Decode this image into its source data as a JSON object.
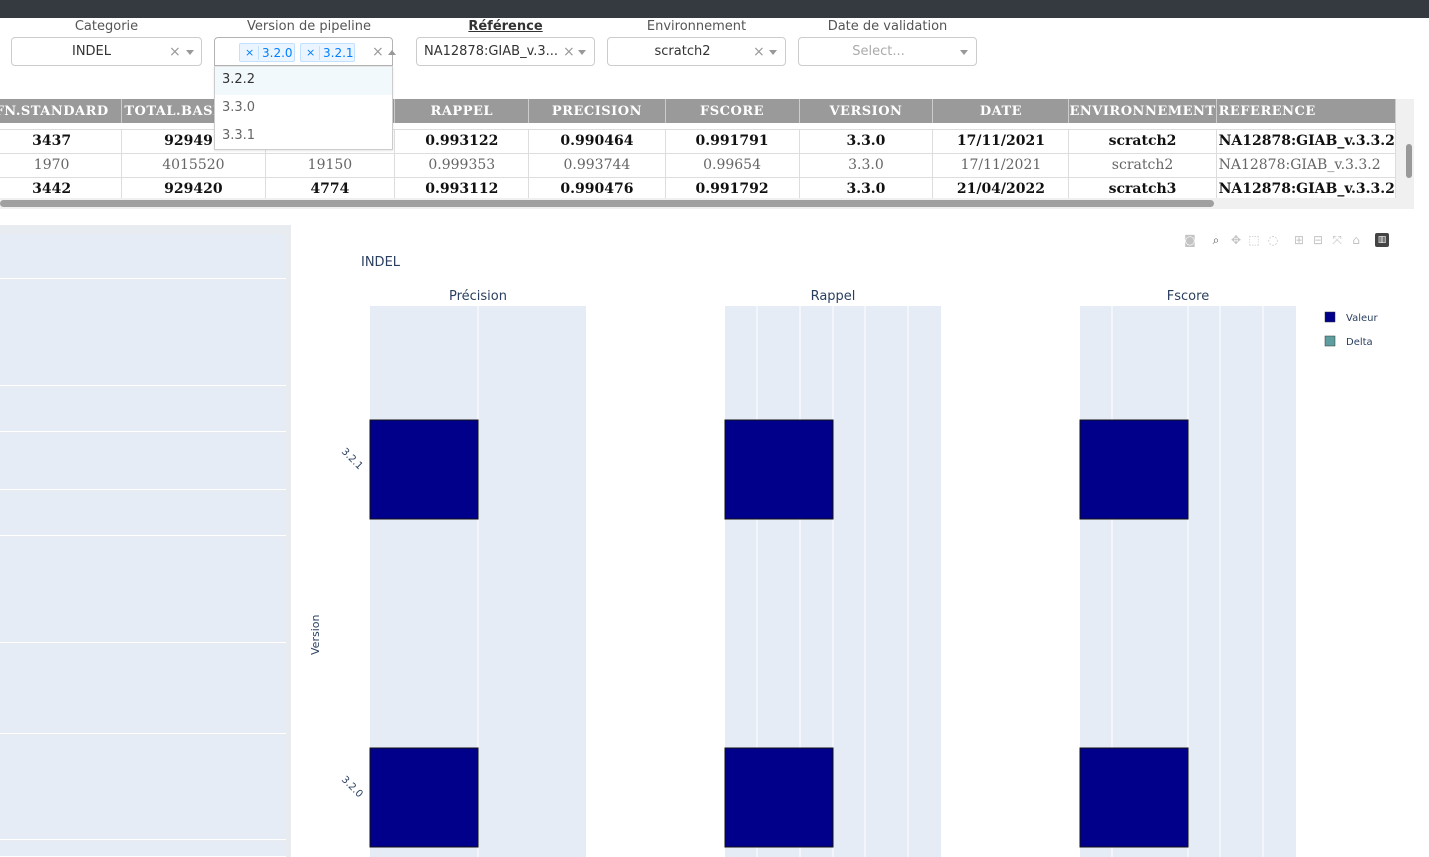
{
  "filters": {
    "categorie": {
      "label": "Categorie",
      "value": "INDEL"
    },
    "version": {
      "label": "Version de pipeline",
      "chips": [
        "3.2.0",
        "3.2.1"
      ],
      "options": [
        "3.2.2",
        "3.3.0",
        "3.3.1"
      ]
    },
    "reference": {
      "label": "Référence",
      "value": "NA12878:GIAB_v.3..."
    },
    "environnement": {
      "label": "Environnement",
      "value": "scratch2"
    },
    "date": {
      "label": "Date de validation",
      "placeholder": "Select..."
    }
  },
  "table": {
    "columns": [
      "FN.STANDARD",
      "TOTAL.BASELINE",
      "",
      "RAPPEL",
      "PRECISION",
      "FSCORE",
      "VERSION",
      "DATE",
      "ENVIRONNEMENT",
      "REFERENCE"
    ],
    "rows": [
      {
        "style": "bold",
        "cells": [
          "3437",
          "929497",
          "",
          "0.993122",
          "0.990464",
          "0.991791",
          "3.3.0",
          "17/11/2021",
          "scratch2",
          "NA12878:GIAB_v.3.3.2"
        ]
      },
      {
        "style": "normal",
        "cells": [
          "1970",
          "4015520",
          "19150",
          "0.999353",
          "0.993744",
          "0.99654",
          "3.3.0",
          "17/11/2021",
          "scratch2",
          "NA12878:GIAB_v.3.3.2"
        ]
      },
      {
        "style": "bold",
        "cells": [
          "3442",
          "929420",
          "4774",
          "0.993112",
          "0.990476",
          "0.991792",
          "3.3.0",
          "21/04/2022",
          "scratch3",
          "NA12878:GIAB_v.3.3.2"
        ]
      }
    ]
  },
  "chart_data": {
    "type": "bar",
    "title": "INDEL",
    "orientation": "horizontal",
    "ylabel": "Version",
    "categories": [
      "3.2.0",
      "3.2.1"
    ],
    "panels": [
      "Précision",
      "Rappel",
      "Fscore"
    ],
    "series": [
      {
        "name": "Valeur",
        "color": "#00008b"
      },
      {
        "name": "Delta",
        "color": "#5f9ea0"
      }
    ],
    "legend_position": "top-right"
  },
  "modebar": [
    "camera-icon",
    "zoom-icon",
    "pan-icon",
    "box-select-icon",
    "lasso-icon",
    "zoom-in-icon",
    "zoom-out-icon",
    "autoscale-icon",
    "reset-axes-icon",
    "plotly-logo-icon"
  ]
}
